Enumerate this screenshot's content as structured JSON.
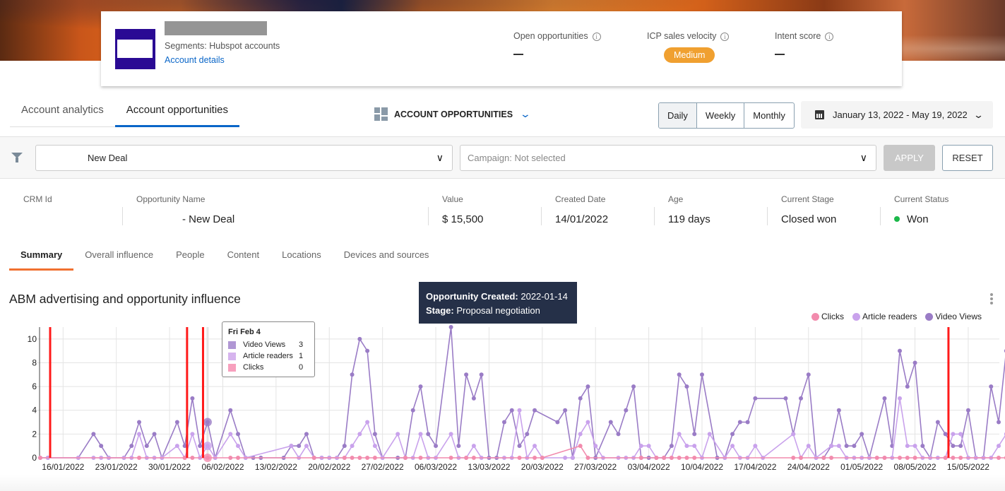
{
  "account": {
    "segments": "Segments: Hubspot accounts",
    "details_link": "Account details",
    "metrics": [
      {
        "label": "Open opportunities",
        "value": "—"
      },
      {
        "label": "ICP sales velocity",
        "value": "Medium"
      },
      {
        "label": "Intent score",
        "value": "—"
      }
    ],
    "badge_color": "#f0a030"
  },
  "tabs": [
    {
      "label": "Account analytics",
      "active": false
    },
    {
      "label": "Account opportunities",
      "active": true
    }
  ],
  "view_selector": {
    "label": "ACCOUNT OPPORTUNITIES"
  },
  "period": {
    "options": [
      "Daily",
      "Weekly",
      "Monthly"
    ],
    "selected": "Daily"
  },
  "date_range": "January 13, 2022 - May 19, 2022",
  "filters": {
    "opportunity_select": "New Deal",
    "campaign_select_placeholder": "Campaign: Not selected",
    "apply_label": "APPLY",
    "reset_label": "RESET"
  },
  "opportunity": {
    "columns": [
      {
        "label": "CRM Id",
        "value": ""
      },
      {
        "label": "Opportunity Name",
        "value": "- New Deal"
      },
      {
        "label": "Value",
        "value": "$ 15,500"
      },
      {
        "label": "Created Date",
        "value": "14/01/2022"
      },
      {
        "label": "Age",
        "value": "119 days"
      },
      {
        "label": "Current Stage",
        "value": "Closed won"
      },
      {
        "label": "Current Status",
        "value": "Won"
      }
    ],
    "status_color": "#1cb84a"
  },
  "subtabs": [
    {
      "label": "Summary",
      "active": true
    },
    {
      "label": "Overall influence",
      "active": false
    },
    {
      "label": "People",
      "active": false
    },
    {
      "label": "Content",
      "active": false
    },
    {
      "label": "Locations",
      "active": false
    },
    {
      "label": "Devices and sources",
      "active": false
    }
  ],
  "annotation": {
    "created_label": "Opportunity Created:",
    "created_value": "2022-01-14",
    "stage_label": "Stage:",
    "stage_value": "Proposal negotiation"
  },
  "tooltip": {
    "title": "Fri Feb 4",
    "rows": [
      {
        "name": "Video Views",
        "value": "3",
        "color": "#b097d4"
      },
      {
        "name": "Article readers",
        "value": "1",
        "color": "#d6b4ee"
      },
      {
        "name": "Clicks",
        "value": "0",
        "color": "#f7a0bd"
      }
    ]
  },
  "chart_data": {
    "type": "line",
    "title": "ABM advertising and opportunity influence",
    "start_date": "2022-01-13",
    "x_unit": "day index from start_date",
    "xlim": [
      0,
      126
    ],
    "ylim": [
      0,
      11
    ],
    "yticks": [
      0,
      2,
      4,
      6,
      8,
      10
    ],
    "xticks": [
      {
        "day": 3,
        "label": "16/01/2022"
      },
      {
        "day": 10,
        "label": "23/01/2022"
      },
      {
        "day": 17,
        "label": "30/01/2022"
      },
      {
        "day": 24,
        "label": "06/02/2022"
      },
      {
        "day": 31,
        "label": "13/02/2022"
      },
      {
        "day": 38,
        "label": "20/02/2022"
      },
      {
        "day": 45,
        "label": "27/02/2022"
      },
      {
        "day": 52,
        "label": "06/03/2022"
      },
      {
        "day": 59,
        "label": "13/03/2022"
      },
      {
        "day": 66,
        "label": "20/03/2022"
      },
      {
        "day": 73,
        "label": "27/03/2022"
      },
      {
        "day": 80,
        "label": "03/04/2022"
      },
      {
        "day": 87,
        "label": "10/04/2022"
      },
      {
        "day": 94,
        "label": "17/04/2022"
      },
      {
        "day": 101,
        "label": "24/04/2022"
      },
      {
        "day": 108,
        "label": "01/05/2022"
      },
      {
        "day": 115,
        "label": "08/05/2022"
      },
      {
        "day": 122,
        "label": "15/05/2022"
      }
    ],
    "grid": true,
    "legend_position": "top-right",
    "legend": [
      "Clicks",
      "Article readers",
      "Video Views"
    ],
    "markers": [
      {
        "day": 1.3,
        "label": "stage change",
        "color": "#ff1a1a"
      },
      {
        "day": 19.3,
        "label": "stage change",
        "color": "#ff1a1a"
      },
      {
        "day": 21.4,
        "label": "stage change",
        "color": "#ff1a1a"
      },
      {
        "day": 119.4,
        "label": "stage change",
        "color": "#ff1a1a"
      }
    ],
    "series": [
      {
        "name": "Video Views",
        "color": "#9a7cc6",
        "points": [
          [
            0,
            0
          ],
          [
            1,
            0
          ],
          [
            5,
            0
          ],
          [
            7,
            2
          ],
          [
            8,
            1
          ],
          [
            9,
            0
          ],
          [
            11,
            0
          ],
          [
            12,
            1
          ],
          [
            13,
            3
          ],
          [
            14,
            1
          ],
          [
            15,
            2
          ],
          [
            16,
            0
          ],
          [
            18,
            3
          ],
          [
            19,
            1
          ],
          [
            20,
            5
          ],
          [
            21,
            1
          ],
          [
            22,
            3
          ],
          [
            23,
            0
          ],
          [
            25,
            4
          ],
          [
            26,
            2
          ],
          [
            27,
            0
          ],
          [
            28,
            0
          ],
          [
            29,
            0
          ],
          [
            32,
            0
          ],
          [
            33,
            1
          ],
          [
            34,
            1
          ],
          [
            35,
            2
          ],
          [
            36,
            0
          ],
          [
            37,
            0
          ],
          [
            38,
            0
          ],
          [
            39,
            0
          ],
          [
            40,
            1
          ],
          [
            41,
            7
          ],
          [
            42,
            10
          ],
          [
            43,
            9
          ],
          [
            44,
            2
          ],
          [
            45,
            0
          ],
          [
            47,
            0
          ],
          [
            48,
            0
          ],
          [
            49,
            4
          ],
          [
            50,
            6
          ],
          [
            51,
            2
          ],
          [
            52,
            1
          ],
          [
            54,
            11
          ],
          [
            55,
            1
          ],
          [
            56,
            7
          ],
          [
            57,
            5
          ],
          [
            58,
            7
          ],
          [
            59,
            0
          ],
          [
            60,
            0
          ],
          [
            61,
            3
          ],
          [
            62,
            4
          ],
          [
            63,
            1
          ],
          [
            64,
            2
          ],
          [
            65,
            4
          ],
          [
            68,
            3
          ],
          [
            69,
            4
          ],
          [
            70,
            0
          ],
          [
            71,
            5
          ],
          [
            72,
            6
          ],
          [
            73,
            0
          ],
          [
            75,
            3
          ],
          [
            76,
            2
          ],
          [
            77,
            4
          ],
          [
            78,
            6
          ],
          [
            79,
            0
          ],
          [
            80,
            0
          ],
          [
            81,
            0
          ],
          [
            82,
            0
          ],
          [
            83,
            1
          ],
          [
            84,
            7
          ],
          [
            85,
            6
          ],
          [
            86,
            2
          ],
          [
            87,
            7
          ],
          [
            89,
            0
          ],
          [
            90,
            0
          ],
          [
            91,
            2
          ],
          [
            92,
            3
          ],
          [
            93,
            3
          ],
          [
            94,
            5
          ],
          [
            98,
            5
          ],
          [
            99,
            2
          ],
          [
            100,
            5
          ],
          [
            101,
            7
          ],
          [
            102,
            0
          ],
          [
            103,
            0
          ],
          [
            104,
            1
          ],
          [
            105,
            4
          ],
          [
            106,
            1
          ],
          [
            107,
            1
          ],
          [
            108,
            2
          ],
          [
            109,
            0
          ],
          [
            111,
            5
          ],
          [
            112,
            1
          ],
          [
            113,
            9
          ],
          [
            114,
            6
          ],
          [
            115,
            8
          ],
          [
            116,
            1
          ],
          [
            117,
            0
          ],
          [
            118,
            3
          ],
          [
            119,
            2
          ],
          [
            120,
            1
          ],
          [
            121,
            1
          ],
          [
            122,
            4
          ],
          [
            123,
            0
          ],
          [
            124,
            0
          ],
          [
            125,
            6
          ],
          [
            126,
            3
          ],
          [
            127,
            9
          ],
          [
            128,
            0
          ]
        ]
      },
      {
        "name": "Article readers",
        "color": "#c9a2ec",
        "points": [
          [
            0,
            0
          ],
          [
            1,
            0
          ],
          [
            5,
            0
          ],
          [
            7,
            0
          ],
          [
            8,
            0
          ],
          [
            9,
            0
          ],
          [
            11,
            0
          ],
          [
            12,
            0
          ],
          [
            13,
            2
          ],
          [
            14,
            0
          ],
          [
            15,
            0
          ],
          [
            16,
            0
          ],
          [
            18,
            1
          ],
          [
            19,
            0
          ],
          [
            20,
            2
          ],
          [
            21,
            0
          ],
          [
            22,
            1
          ],
          [
            23,
            0
          ],
          [
            25,
            2
          ],
          [
            26,
            1
          ],
          [
            27,
            0
          ],
          [
            33,
            1
          ],
          [
            34,
            0
          ],
          [
            35,
            1
          ],
          [
            36,
            0
          ],
          [
            37,
            0
          ],
          [
            38,
            0
          ],
          [
            39,
            0
          ],
          [
            40,
            0
          ],
          [
            41,
            1
          ],
          [
            42,
            2
          ],
          [
            43,
            3
          ],
          [
            44,
            1
          ],
          [
            45,
            0
          ],
          [
            47,
            2
          ],
          [
            48,
            0
          ],
          [
            49,
            0
          ],
          [
            50,
            2
          ],
          [
            51,
            0
          ],
          [
            52,
            0
          ],
          [
            54,
            2
          ],
          [
            55,
            0
          ],
          [
            56,
            0
          ],
          [
            57,
            1
          ],
          [
            58,
            0
          ],
          [
            61,
            0
          ],
          [
            62,
            0
          ],
          [
            63,
            4
          ],
          [
            64,
            0
          ],
          [
            65,
            1
          ],
          [
            66,
            0
          ],
          [
            69,
            0
          ],
          [
            70,
            0
          ],
          [
            71,
            2
          ],
          [
            72,
            3
          ],
          [
            73,
            1
          ],
          [
            74,
            0
          ],
          [
            76,
            0
          ],
          [
            77,
            0
          ],
          [
            78,
            0
          ],
          [
            79,
            1
          ],
          [
            80,
            1
          ],
          [
            81,
            0
          ],
          [
            82,
            0
          ],
          [
            83,
            0
          ],
          [
            84,
            2
          ],
          [
            85,
            1
          ],
          [
            86,
            1
          ],
          [
            87,
            0
          ],
          [
            88,
            2
          ],
          [
            90,
            0
          ],
          [
            91,
            1
          ],
          [
            92,
            0
          ],
          [
            93,
            0
          ],
          [
            94,
            1
          ],
          [
            95,
            0
          ],
          [
            99,
            2
          ],
          [
            100,
            0
          ],
          [
            101,
            1
          ],
          [
            102,
            0
          ],
          [
            104,
            1
          ],
          [
            105,
            1
          ],
          [
            106,
            0
          ],
          [
            107,
            0
          ],
          [
            108,
            0
          ],
          [
            109,
            0
          ],
          [
            111,
            0
          ],
          [
            112,
            0
          ],
          [
            113,
            5
          ],
          [
            114,
            1
          ],
          [
            115,
            1
          ],
          [
            116,
            0
          ],
          [
            117,
            0
          ],
          [
            118,
            0
          ],
          [
            119,
            0
          ],
          [
            120,
            2
          ],
          [
            121,
            2
          ],
          [
            122,
            0
          ],
          [
            123,
            0
          ],
          [
            124,
            0
          ],
          [
            125,
            0
          ],
          [
            126,
            1
          ],
          [
            127,
            2
          ],
          [
            128,
            0
          ]
        ]
      },
      {
        "name": "Clicks",
        "color": "#f28bad",
        "points": [
          [
            0,
            0
          ],
          [
            13,
            0
          ],
          [
            19,
            0
          ],
          [
            20,
            0
          ],
          [
            22,
            0
          ],
          [
            25,
            0
          ],
          [
            26,
            0
          ],
          [
            36,
            0
          ],
          [
            40,
            0
          ],
          [
            41,
            0
          ],
          [
            42,
            0
          ],
          [
            43,
            0
          ],
          [
            44,
            0
          ],
          [
            48,
            0
          ],
          [
            50,
            0
          ],
          [
            54,
            0
          ],
          [
            56,
            0
          ],
          [
            57,
            0
          ],
          [
            63,
            0
          ],
          [
            65,
            0
          ],
          [
            66,
            0
          ],
          [
            71,
            1
          ],
          [
            72,
            0
          ],
          [
            79,
            0
          ],
          [
            81,
            0
          ],
          [
            82,
            0
          ],
          [
            83,
            0
          ],
          [
            84,
            0
          ],
          [
            85,
            0
          ],
          [
            86,
            0
          ],
          [
            99,
            0
          ],
          [
            100,
            0
          ],
          [
            103,
            0
          ],
          [
            104,
            0
          ],
          [
            110,
            0
          ],
          [
            111,
            0
          ],
          [
            113,
            0
          ],
          [
            114,
            0
          ],
          [
            115,
            0
          ],
          [
            119,
            0
          ],
          [
            120,
            0
          ],
          [
            121,
            0
          ],
          [
            126,
            0
          ],
          [
            127,
            0
          ],
          [
            128,
            0
          ]
        ]
      }
    ],
    "highlight": {
      "day": 22,
      "label": "Fri Feb 4"
    }
  }
}
